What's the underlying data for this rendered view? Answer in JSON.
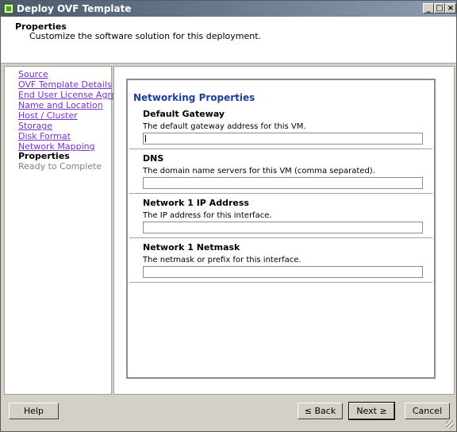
{
  "window": {
    "title": "Deploy OVF Template",
    "controls": {
      "minimize": "_",
      "maximize": "□",
      "close": "×"
    }
  },
  "header": {
    "title": "Properties",
    "subtitle": "Customize the software solution for this deployment."
  },
  "nav": {
    "items": [
      {
        "label": "Source",
        "state": "link"
      },
      {
        "label": "OVF Template Details",
        "state": "link"
      },
      {
        "label": "End User License Agreement",
        "state": "link"
      },
      {
        "label": "Name and Location",
        "state": "link"
      },
      {
        "label": "Host / Cluster",
        "state": "link"
      },
      {
        "label": "Storage",
        "state": "link"
      },
      {
        "label": "Disk Format",
        "state": "link"
      },
      {
        "label": "Network Mapping",
        "state": "link"
      },
      {
        "label": "Properties",
        "state": "current"
      },
      {
        "label": "Ready to Complete",
        "state": "disabled"
      }
    ]
  },
  "networking": {
    "title": "Networking Properties",
    "sections": [
      {
        "label": "Default Gateway",
        "description": "The default gateway address for this VM.",
        "value": ""
      },
      {
        "label": "DNS",
        "description": "The domain name servers for this VM (comma separated).",
        "value": ""
      },
      {
        "label": "Network 1 IP Address",
        "description": "The IP address for this interface.",
        "value": ""
      },
      {
        "label": "Network 1 Netmask",
        "description": "The netmask or prefix for this interface.",
        "value": ""
      }
    ]
  },
  "buttons": {
    "help": "Help",
    "back": "≤ Back",
    "next": "Next ≥",
    "cancel": "Cancel"
  },
  "colors": {
    "link": "#7a30c8",
    "section_title": "#1c3e9c",
    "titlebar": "#4a5a6c"
  }
}
